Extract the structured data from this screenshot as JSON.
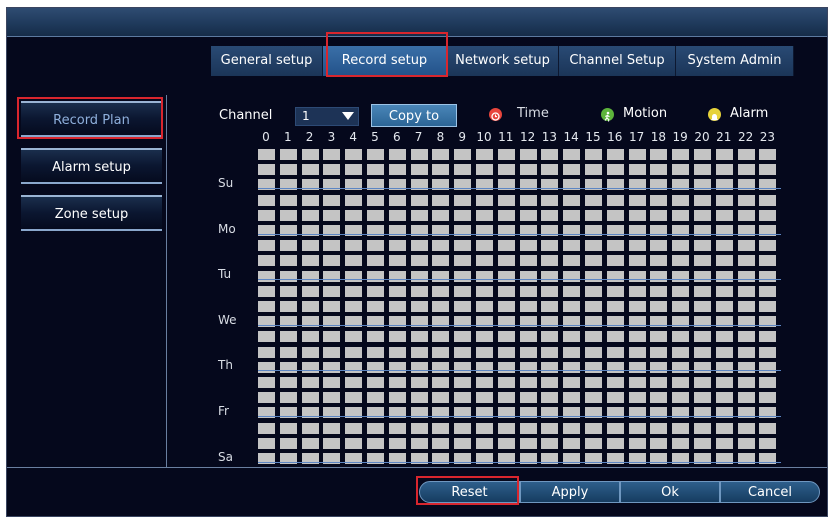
{
  "tabs": [
    {
      "label": "General setup"
    },
    {
      "label": "Record setup",
      "active": true
    },
    {
      "label": "Network setup"
    },
    {
      "label": "Channel Setup"
    },
    {
      "label": "System Admin"
    }
  ],
  "sidebar": {
    "items": [
      {
        "label": "Record Plan",
        "active": true
      },
      {
        "label": "Alarm setup"
      },
      {
        "label": "Zone setup"
      }
    ]
  },
  "toolbar": {
    "channel_label": "Channel",
    "channel_value": "1",
    "copy_label": "Copy to"
  },
  "legend": [
    {
      "label": "Time",
      "color": "#e8453c",
      "icon": "clock-icon"
    },
    {
      "label": "Motion",
      "color": "#5db43b",
      "icon": "running-person-icon"
    },
    {
      "label": "Alarm",
      "color": "#e6d23a",
      "icon": "alarm-icon"
    }
  ],
  "schedule": {
    "hours": [
      "0",
      "1",
      "2",
      "3",
      "4",
      "5",
      "6",
      "7",
      "8",
      "9",
      "10",
      "11",
      "12",
      "13",
      "14",
      "15",
      "16",
      "17",
      "18",
      "19",
      "20",
      "21",
      "22",
      "23"
    ],
    "days": [
      "Su",
      "Mo",
      "Tu",
      "We",
      "Th",
      "Fr",
      "Sa"
    ],
    "cell_color": "#c4c4c4"
  },
  "footer": {
    "reset_label": "Reset",
    "apply_label": "Apply",
    "ok_label": "Ok",
    "cancel_label": "Cancel"
  },
  "highlight_color": "#d9262e"
}
